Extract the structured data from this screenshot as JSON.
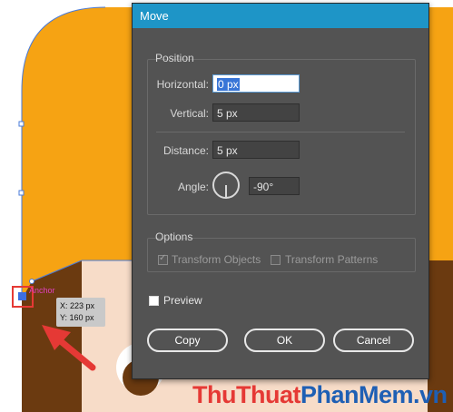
{
  "dialog": {
    "title": "Move",
    "position": {
      "group_label": "Position",
      "horizontal_label": "Horizontal:",
      "horizontal_value": "0 px",
      "vertical_label": "Vertical:",
      "vertical_value": "5 px",
      "distance_label": "Distance:",
      "distance_value": "5 px",
      "angle_label": "Angle:",
      "angle_value": "-90°"
    },
    "options": {
      "group_label": "Options",
      "transform_objects": "Transform Objects",
      "transform_patterns": "Transform Patterns"
    },
    "preview_label": "Preview",
    "buttons": {
      "copy": "Copy",
      "ok": "OK",
      "cancel": "Cancel"
    }
  },
  "canvas": {
    "anchor_label": "Anchor",
    "tooltip_x": "X: 223 px",
    "tooltip_y": "Y: 160 px"
  },
  "watermark": {
    "part1": "Thu",
    "part2": "Thuat",
    "part3": "PhanMem",
    "part4": ".vn"
  },
  "colors": {
    "orange": "#f6a313",
    "brown": "#6b3a10",
    "peach": "#f7dcc8",
    "dialog_bg": "#535353",
    "titlebar": "#1e95c7",
    "highlight_red": "#e53935"
  }
}
